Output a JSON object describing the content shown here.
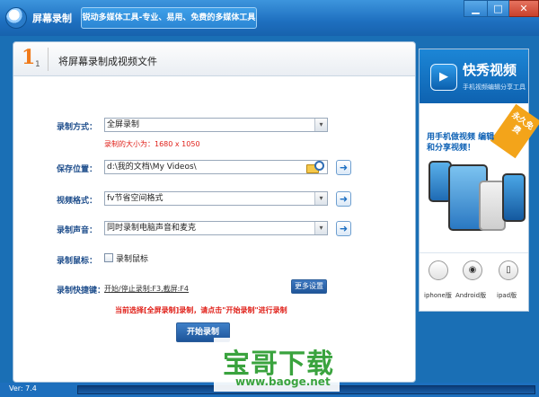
{
  "window": {
    "title": "屏幕录制",
    "slogan": "锐动多媒体工具-专业、易用、免费的多媒体工具",
    "minimize": "▁",
    "maximize": "□",
    "close": "✕"
  },
  "step": {
    "number": "1",
    "sub_number": "1",
    "title": "将屏幕录制成视频文件"
  },
  "form": {
    "mode_label": "录制方式：",
    "mode_value": "全屏录制",
    "size_note": "录制的大小为：1680 x 1050",
    "save_label": "保存位置：",
    "save_value": "d:\\我的文档\\My Videos\\",
    "format_label": "视频格式：",
    "format_value": "fv节省空间格式",
    "audio_label": "录制声音：",
    "audio_value": "同时录制电脑声音和麦克",
    "mouse_label": "录制鼠标：",
    "mouse_checkbox_label": "录制鼠标",
    "mouse_checked": false,
    "hotkey_label": "录制快捷键：",
    "hotkey_value": "开始/停止录制:F3,截屏:F4",
    "more_settings": "更多设置",
    "hint": "当前选择[全屏录制]录制，请点击\"开始录制\"进行录制",
    "start_button": "开始录制",
    "dropdown_glyph": "▾",
    "go_glyph": "➜"
  },
  "ad": {
    "brand": "快秀视频",
    "tagline": "手机视频编辑分享工具",
    "ribbon": "永久免费",
    "promo": "用手机做视频 编辑和分享视频！",
    "platforms": [
      {
        "icon": "apple-icon",
        "glyph": "",
        "label": "iphone版"
      },
      {
        "icon": "android-icon",
        "glyph": "◉",
        "label": "Android版"
      },
      {
        "icon": "ipad-icon",
        "glyph": "▯",
        "label": "ipad版"
      }
    ]
  },
  "status": {
    "version": "Ver: 7.4"
  },
  "watermark": {
    "text": "宝哥下载",
    "url": "www.baoge.net"
  }
}
